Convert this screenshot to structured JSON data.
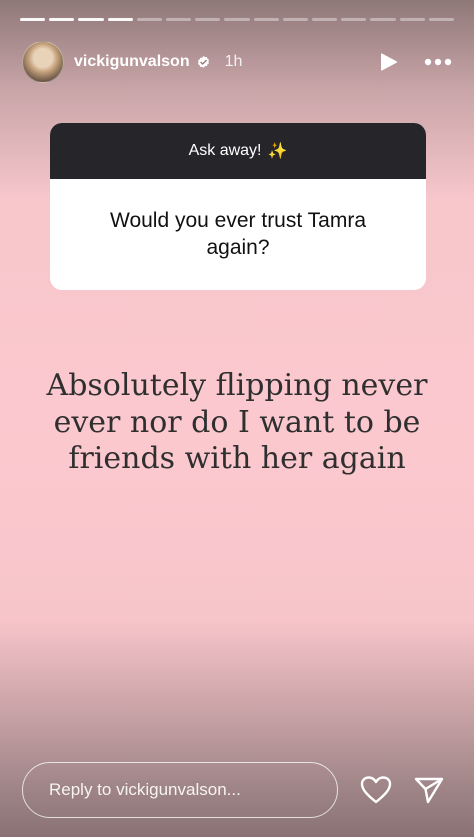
{
  "header": {
    "username": "vickigunvalson",
    "time": "1h"
  },
  "progress": {
    "total_segments": 15,
    "completed_segments": 4
  },
  "question_box": {
    "title": "Ask away!",
    "sparkle": "✨",
    "question": "Would you ever trust Tamra again?"
  },
  "answer_text": "Absolutely flipping never ever nor do I want to be friends with her again",
  "reply": {
    "placeholder": "Reply to vickigunvalson..."
  },
  "colors": {
    "background": "#fbc8ce",
    "question_header": "#26262a",
    "text": "#2f2f2f"
  }
}
